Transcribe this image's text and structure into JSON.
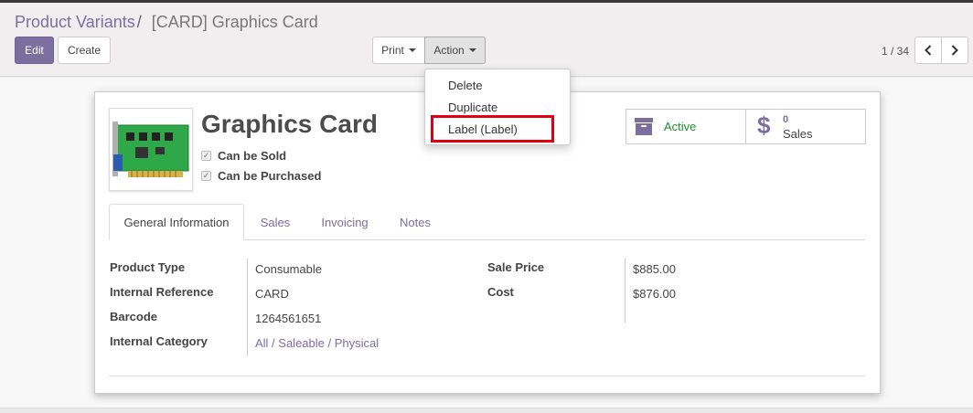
{
  "breadcrumb": {
    "parent": "Product Variants",
    "separator": "/",
    "current": "[CARD] Graphics Card"
  },
  "toolbar": {
    "edit_label": "Edit",
    "create_label": "Create",
    "print_label": "Print",
    "action_label": "Action"
  },
  "pager": {
    "value": "1 / 34"
  },
  "action_menu": {
    "items": [
      "Delete",
      "Duplicate",
      "Label (Label)"
    ],
    "highlighted_item": "Label (Label)"
  },
  "product": {
    "title": "Graphics Card",
    "can_be_sold_label": "Can be Sold",
    "can_be_purchased_label": "Can be Purchased",
    "can_be_sold": true,
    "can_be_purchased": true
  },
  "smart_buttons": {
    "active_label": "Active",
    "sales_count": "0",
    "sales_label": "Sales"
  },
  "tabs": [
    "General Information",
    "Sales",
    "Invoicing",
    "Notes"
  ],
  "fields_left": [
    {
      "label": "Product Type",
      "value": "Consumable"
    },
    {
      "label": "Internal Reference",
      "value": "CARD"
    },
    {
      "label": "Barcode",
      "value": "1264561651"
    },
    {
      "label": "Internal Category",
      "value": "All / Saleable / Physical"
    }
  ],
  "fields_right": [
    {
      "label": "Sale Price",
      "value": "$885.00"
    },
    {
      "label": "Cost",
      "value": "$876.00"
    }
  ],
  "colors": {
    "brand": "#7c6e9f",
    "active_green": "#1f8f34",
    "highlight_red": "#e0000f"
  }
}
